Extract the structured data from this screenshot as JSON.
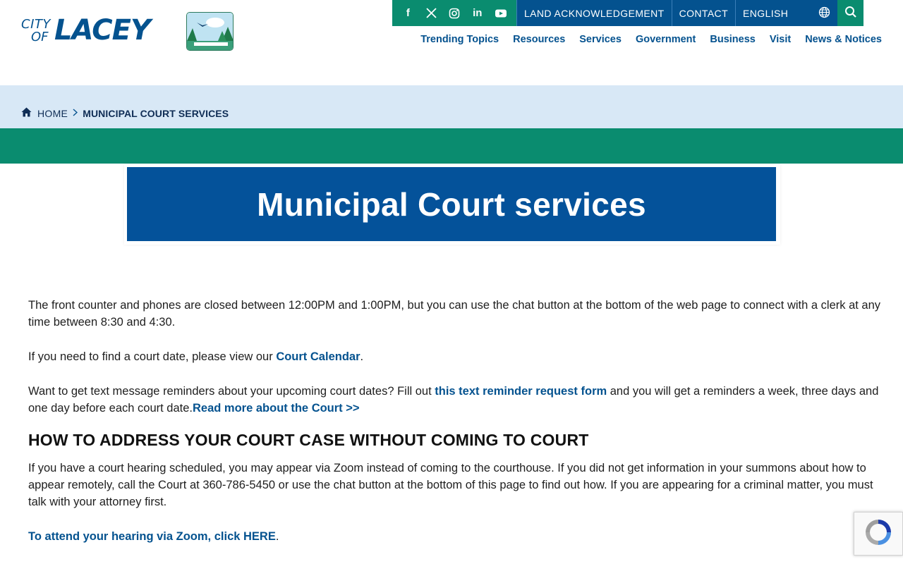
{
  "brand": {
    "logo_city": "CITY",
    "logo_of": "OF",
    "logo_name": "LACEY"
  },
  "topbar": {
    "social_icons": [
      "facebook-icon",
      "x-icon",
      "instagram-icon",
      "linkedin-icon",
      "youtube-icon"
    ],
    "land_acknowledgement": "LAND ACKNOWLEDGEMENT",
    "contact": "CONTACT",
    "language": "ENGLISH"
  },
  "nav": {
    "items": [
      "Trending Topics",
      "Resources",
      "Services",
      "Government",
      "Business",
      "Visit",
      "News & Notices"
    ]
  },
  "breadcrumb": {
    "home": "HOME",
    "current": "MUNICIPAL COURT SERVICES"
  },
  "page": {
    "title": "Municipal Court services",
    "p1": "The front counter and phones are closed between 12:00PM and 1:00PM, but you can use the chat button at the bottom of the web page to connect with a clerk at any time between 8:30 and 4:30.",
    "p2_before": "If you need to find a court date, please view our ",
    "p2_link": "Court Calendar",
    "p2_after": ".",
    "p3_before": "Want to get text message reminders about your upcoming court dates? Fill out ",
    "p3_link": "this text reminder request form",
    "p3_middle": " and you will get a reminders a week, three days and one day before each court date.",
    "p3_link2": "Read more about the Court >>",
    "heading": "HOW TO ADDRESS YOUR COURT CASE WITHOUT COMING TO COURT",
    "p4": "If you have a court hearing scheduled, you may appear via Zoom instead of coming to the courthouse. If you did not get information in your summons about how to appear remotely, call the Court at 360-786-5450 or use the chat button at the bottom of this page to find out how. If you are appearing for a criminal matter, you must talk with your attorney first.",
    "p5_link": "To attend your hearing via Zoom, click HERE",
    "p5_after": "."
  },
  "colors": {
    "primary_blue": "#04528f",
    "green": "#0a8c6f",
    "breadcrumb_bg": "#d8e8f6"
  }
}
